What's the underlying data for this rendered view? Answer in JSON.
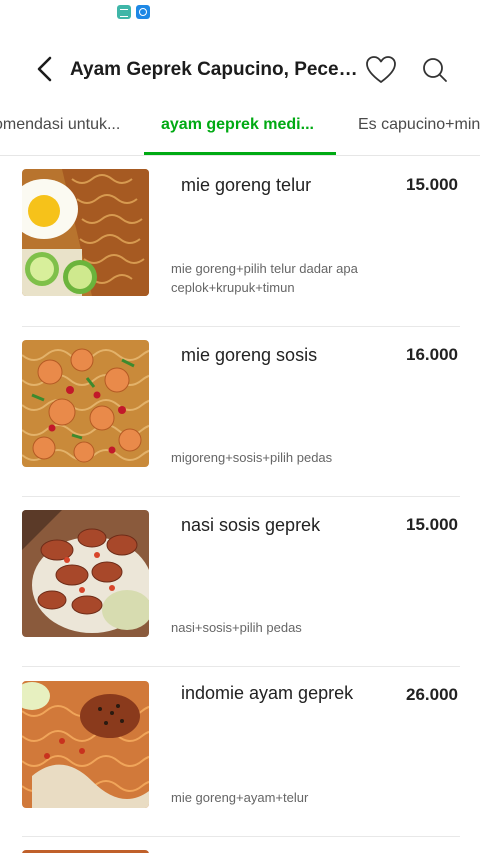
{
  "header": {
    "title": "Ayam Geprek Capucino, Pecel L..."
  },
  "tabs": [
    {
      "label": "omendasi untuk..."
    },
    {
      "label": "ayam geprek medi..."
    },
    {
      "label": "Es capucino+min"
    }
  ],
  "items": [
    {
      "name": "mie goreng telur",
      "price": "15.000",
      "desc": "mie goreng+pilih telur dadar apa ceplok+krupuk+timun"
    },
    {
      "name": "mie goreng sosis",
      "price": "16.000",
      "desc": "migoreng+sosis+pilih pedas"
    },
    {
      "name": "nasi sosis geprek",
      "price": "15.000",
      "desc": "nasi+sosis+pilih pedas"
    },
    {
      "name": "indomie ayam geprek",
      "price": "26.000",
      "desc": "mie goreng+ayam+telur"
    }
  ],
  "colors": {
    "accent": "#00aa13"
  },
  "icons": [
    "back-arrow-icon",
    "heart-icon",
    "search-icon"
  ]
}
